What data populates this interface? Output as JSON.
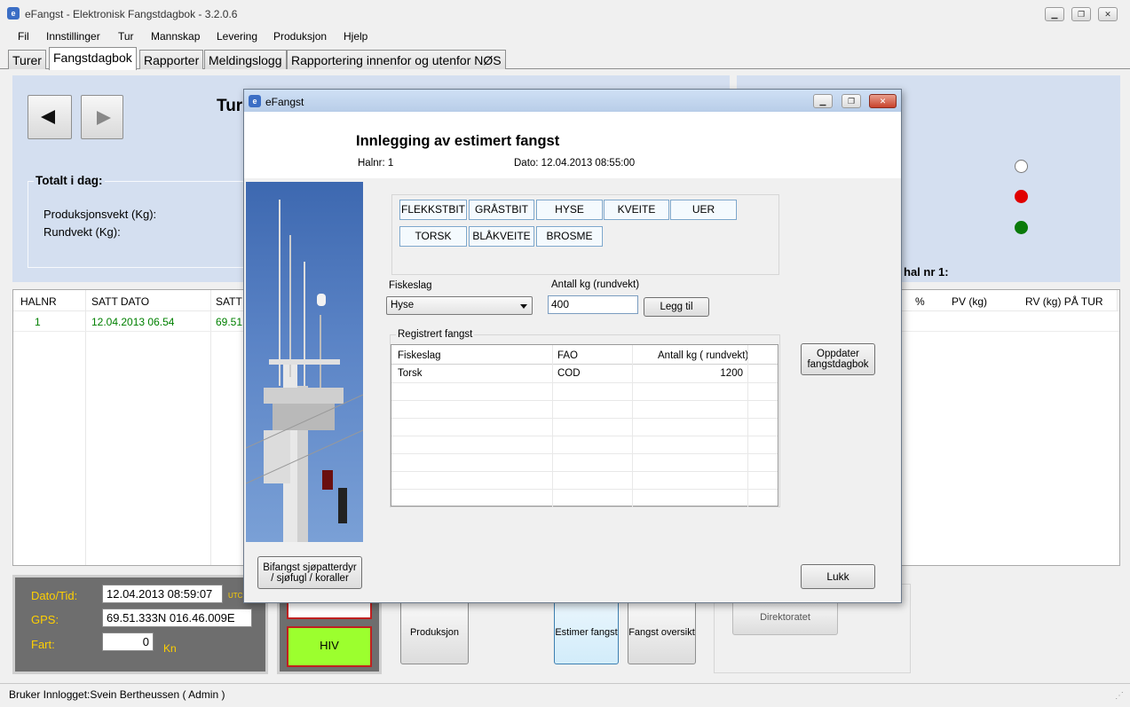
{
  "window": {
    "title": "eFangst - Elektronisk Fangstdagbok - 3.2.0.6",
    "icon": "efangst-icon"
  },
  "menu": [
    "Fil",
    "Innstillinger",
    "Tur",
    "Mannskap",
    "Levering",
    "Produksjon",
    "Hjelp"
  ],
  "tabs": [
    "Turer",
    "Fangstdagbok",
    "Rapporter",
    "Meldingslogg",
    "Rapportering innenfor og utenfor NØS"
  ],
  "active_tab": "Fangstdagbok",
  "top_panel": {
    "title_partial": "Tur",
    "totals_title": "Totalt i dag:",
    "prod_label": "Produksjonsvekt (Kg):",
    "rund_label": "Rundvekt (Kg):",
    "hal_label": "hal nr 1:"
  },
  "grid": {
    "headers": [
      "HALNR",
      "SATT DATO",
      "SATT"
    ],
    "right_headers": [
      "%",
      "PV (kg)",
      "RV (kg) PÅ TUR"
    ],
    "rows": [
      {
        "halnr": "1",
        "satt_dato": "12.04.2013 06.54",
        "satt": "69.51"
      }
    ],
    "row_color": "#008000"
  },
  "status_lights": [
    "white",
    "red",
    "green"
  ],
  "gps_panel": {
    "dato_label": "Dato/Tid:",
    "dato_value": "12.04.2013 08:59:07",
    "utc": "UTC",
    "gps_label": "GPS:",
    "gps_value": "69.51.333N 016.46.009E",
    "fart_label": "Fart:",
    "fart_value": "0",
    "fart_unit": "Kn"
  },
  "hiv_button": "HIV",
  "bottom_buttons": {
    "produksjon": "Produksjon",
    "estimer": "Estimer fangst",
    "fangst_oversikt": "Fangst oversikt",
    "direktoratet": "Direktoratet"
  },
  "status_bar": "Bruker Innlogget:Svein Bertheussen ( Admin )",
  "dialog": {
    "title": "eFangst",
    "heading": "Innlegging av estimert fangst",
    "halnr": "Halnr: 1",
    "dato": "Dato: 12.04.2013 08:55:00",
    "fish_buttons": [
      "FLEKKSTBIT",
      "GRÅSTBIT",
      "HYSE",
      "KVEITE",
      "UER",
      "TORSK",
      "BLÅKVEITE",
      "BROSME"
    ],
    "fiskeslag_label": "Fiskeslag",
    "fiskeslag_value": "Hyse",
    "antall_label": "Antall kg (rundvekt)",
    "antall_value": "400",
    "legg_til": "Legg til",
    "registrert_label": "Registrert fangst",
    "table_headers": [
      "Fiskeslag",
      "FAO",
      "Antall kg ( rundvekt)"
    ],
    "table_rows": [
      {
        "fiskeslag": "Torsk",
        "fao": "COD",
        "antall": "1200"
      }
    ],
    "oppdater": "Oppdater fangstdagbok",
    "bifangst": "Bifangst sjøpatterdyr / sjøfugl / koraller",
    "lukk": "Lukk"
  }
}
